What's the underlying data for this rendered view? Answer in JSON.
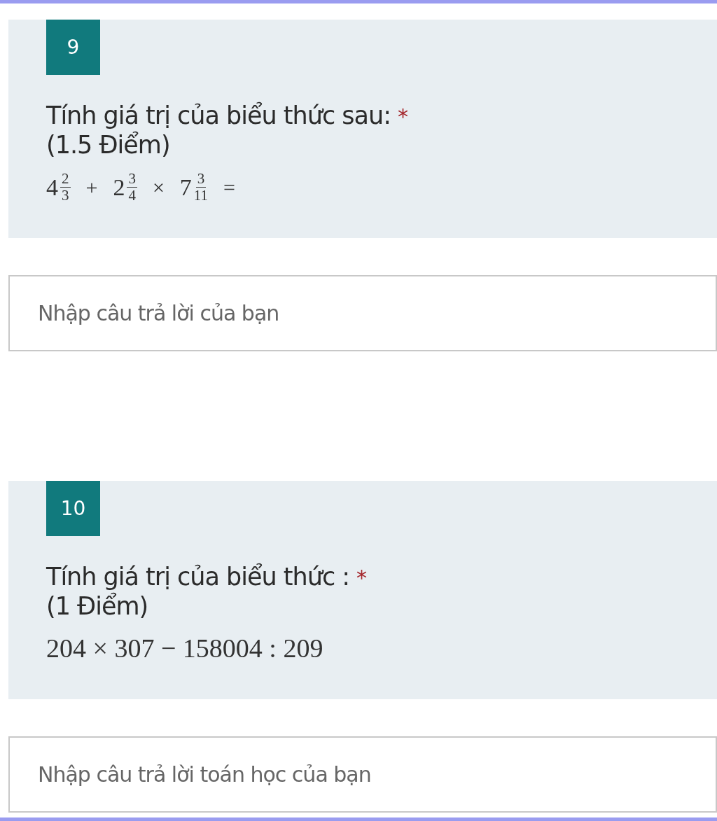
{
  "questions": [
    {
      "number": "9",
      "title": "Tính giá trị của biểu thức sau:",
      "required_mark": "*",
      "points": "(1.5 Điểm)",
      "expression": [
        {
          "kind": "mixed",
          "whole": "4",
          "num": "2",
          "den": "3"
        },
        {
          "kind": "op",
          "text": "+"
        },
        {
          "kind": "mixed",
          "whole": "2",
          "num": "3",
          "den": "4"
        },
        {
          "kind": "op",
          "text": "×"
        },
        {
          "kind": "mixed",
          "whole": "7",
          "num": "3",
          "den": "11"
        },
        {
          "kind": "op",
          "text": "="
        }
      ],
      "answer": {
        "placeholder": "Nhập câu trả lời của bạn"
      }
    },
    {
      "number": "10",
      "title": "Tính giá trị của biểu thức :",
      "required_mark": "*",
      "points": "(1 Điểm)",
      "expression": [
        {
          "kind": "text",
          "text": "204 × 307 − 158004 : 209"
        }
      ],
      "answer": {
        "placeholder": "Nhập câu trả lời toán học của bạn"
      }
    }
  ]
}
